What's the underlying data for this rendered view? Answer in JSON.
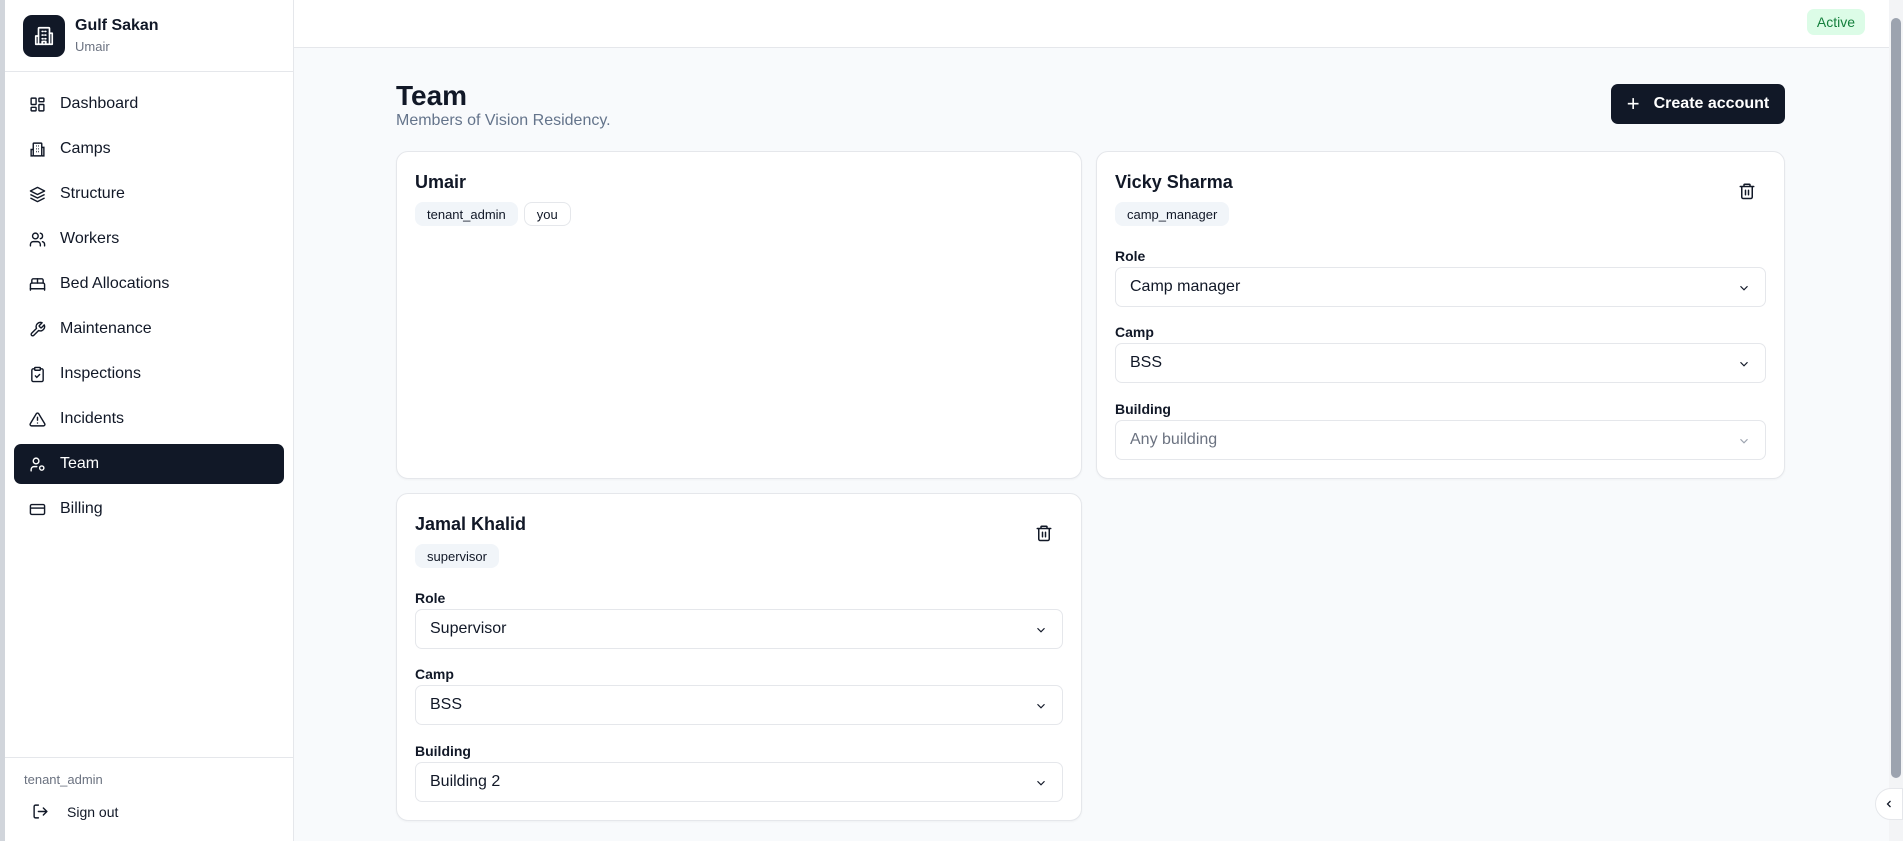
{
  "brand": {
    "name": "Gulf Sakan",
    "user": "Umair"
  },
  "sidebar": {
    "items": [
      {
        "label": "Dashboard",
        "icon": "dashboard-icon"
      },
      {
        "label": "Camps",
        "icon": "building-icon"
      },
      {
        "label": "Structure",
        "icon": "layers-icon"
      },
      {
        "label": "Workers",
        "icon": "users-icon"
      },
      {
        "label": "Bed Allocations",
        "icon": "bed-icon"
      },
      {
        "label": "Maintenance",
        "icon": "wrench-icon"
      },
      {
        "label": "Inspections",
        "icon": "clipboard-check-icon"
      },
      {
        "label": "Incidents",
        "icon": "alert-triangle-icon"
      },
      {
        "label": "Team",
        "icon": "user-cog-icon",
        "active": true
      },
      {
        "label": "Billing",
        "icon": "credit-card-icon"
      }
    ],
    "footer_role": "tenant_admin",
    "signout_label": "Sign out"
  },
  "topbar": {
    "status": "Active"
  },
  "page": {
    "title": "Team",
    "subtitle": "Members of Vision Residency.",
    "create_label": "Create account"
  },
  "members": [
    {
      "name": "Umair",
      "chips": [
        "tenant_admin",
        "you"
      ]
    },
    {
      "name": "Vicky Sharma",
      "chips": [
        "camp_manager"
      ],
      "role_label": "Role",
      "role": "Camp manager",
      "camp_label": "Camp",
      "camp": "BSS",
      "building_label": "Building",
      "building": "Any building"
    },
    {
      "name": "Jamal Khalid",
      "chips": [
        "supervisor"
      ],
      "role_label": "Role",
      "role": "Supervisor",
      "camp_label": "Camp",
      "camp": "BSS",
      "building_label": "Building",
      "building": "Building 2"
    }
  ],
  "colors": {
    "primary": "#111827",
    "active_badge_bg": "#dcfce7",
    "active_badge_text": "#15803d"
  }
}
